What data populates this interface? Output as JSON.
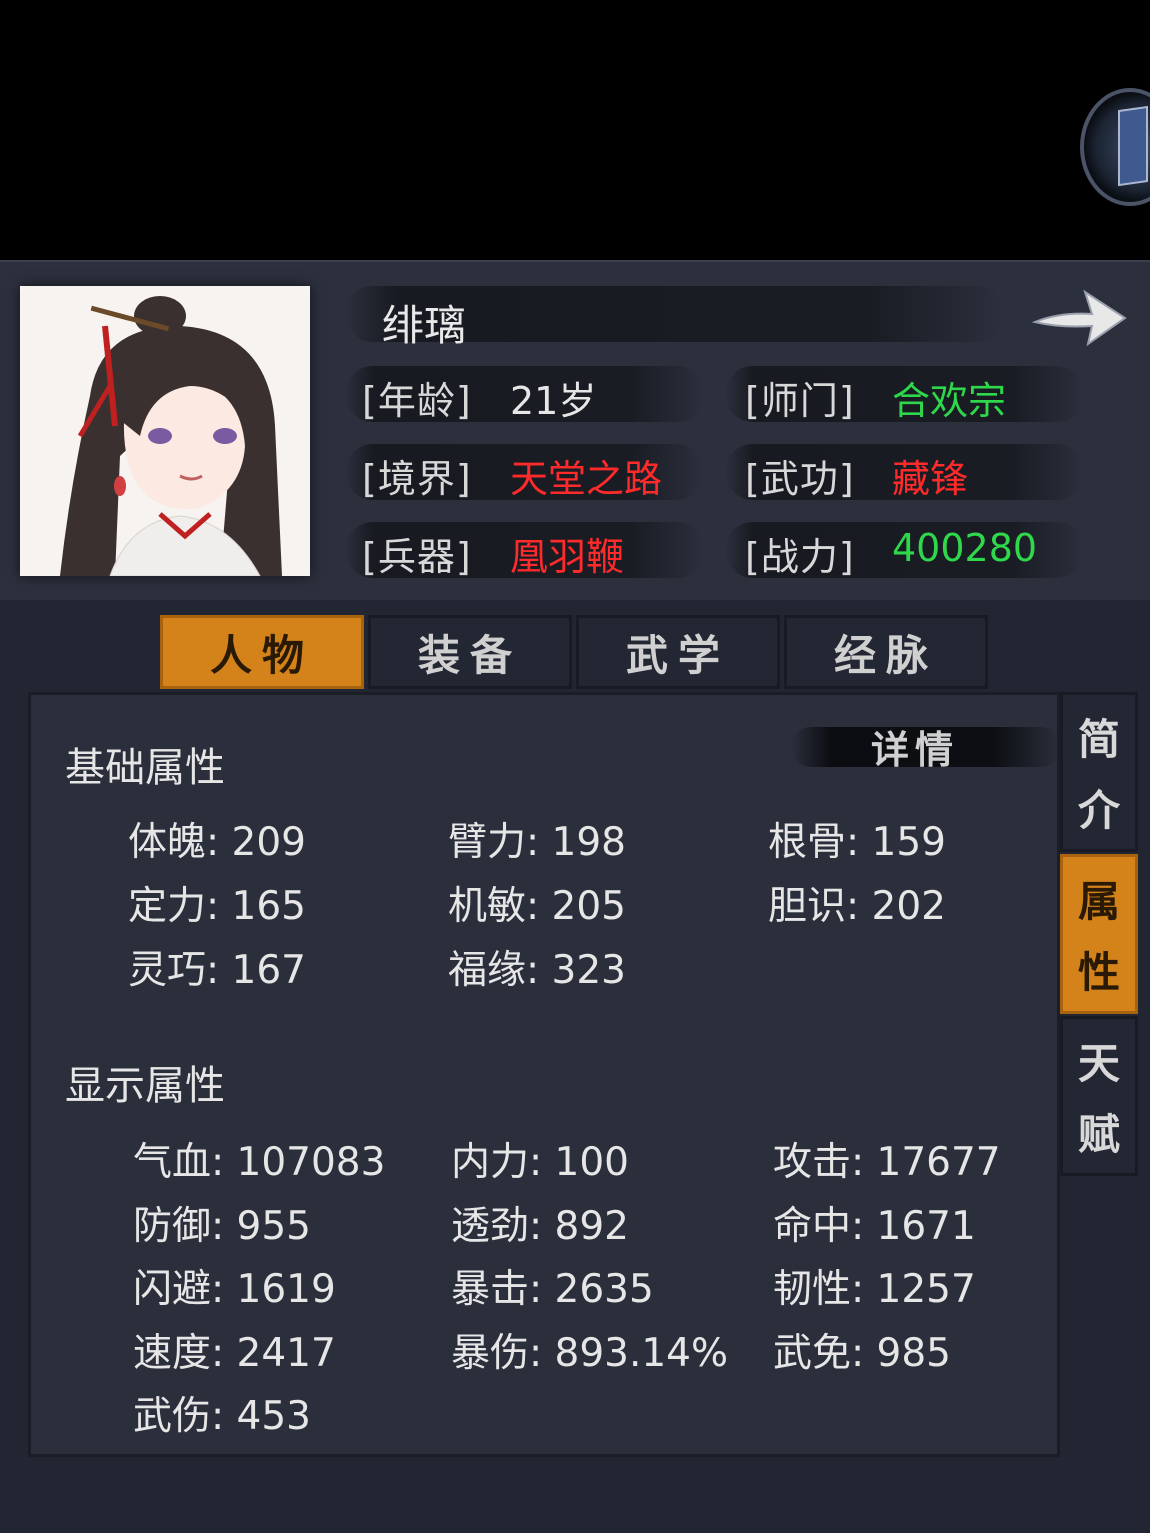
{
  "character": {
    "name": "绯璃",
    "info": [
      {
        "label": "[年龄]",
        "value": "21岁",
        "color": "#e6e6e6"
      },
      {
        "label": "[师门]",
        "value": "合欢宗",
        "color": "#2ed84a"
      },
      {
        "label": "[境界]",
        "value": "天堂之路",
        "color": "#ff2a2a"
      },
      {
        "label": "[武功]",
        "value": "藏锋",
        "color": "#ff2a2a"
      },
      {
        "label": "[兵器]",
        "value": "凰羽鞭",
        "color": "#ff2a2a"
      },
      {
        "label": "[战力]",
        "value": "400280",
        "color": "#2ed84a"
      }
    ]
  },
  "tabs": [
    {
      "label": "人物",
      "active": true
    },
    {
      "label": "装备",
      "active": false
    },
    {
      "label": "武学",
      "active": false
    },
    {
      "label": "经脉",
      "active": false
    }
  ],
  "side_tabs": [
    {
      "chars": [
        "简",
        "介"
      ],
      "active": false
    },
    {
      "chars": [
        "属",
        "性"
      ],
      "active": true
    },
    {
      "chars": [
        "天",
        "赋"
      ],
      "active": false
    }
  ],
  "detail_button": "详情",
  "base": {
    "title": "基础属性",
    "stats": [
      "体魄: 209",
      "臂力: 198",
      "根骨: 159",
      "定力: 165",
      "机敏: 205",
      "胆识: 202",
      "灵巧: 167",
      "福缘: 323"
    ]
  },
  "display": {
    "title": "显示属性",
    "stats": [
      "气血: 107083",
      "内力: 100",
      "攻击: 17677",
      "防御: 955",
      "透劲: 892",
      "命中: 1671",
      "闪避: 1619",
      "暴击: 2635",
      "韧性: 1257",
      "速度: 2417",
      "暴伤: 893.14%",
      "武免: 985",
      "武伤: 453"
    ]
  },
  "icons": {
    "arrow": "right-arrow-icon",
    "badge": "book-icon"
  },
  "colors": {
    "accent": "#d4831b",
    "red": "#ff2a2a",
    "green": "#2ed84a"
  }
}
